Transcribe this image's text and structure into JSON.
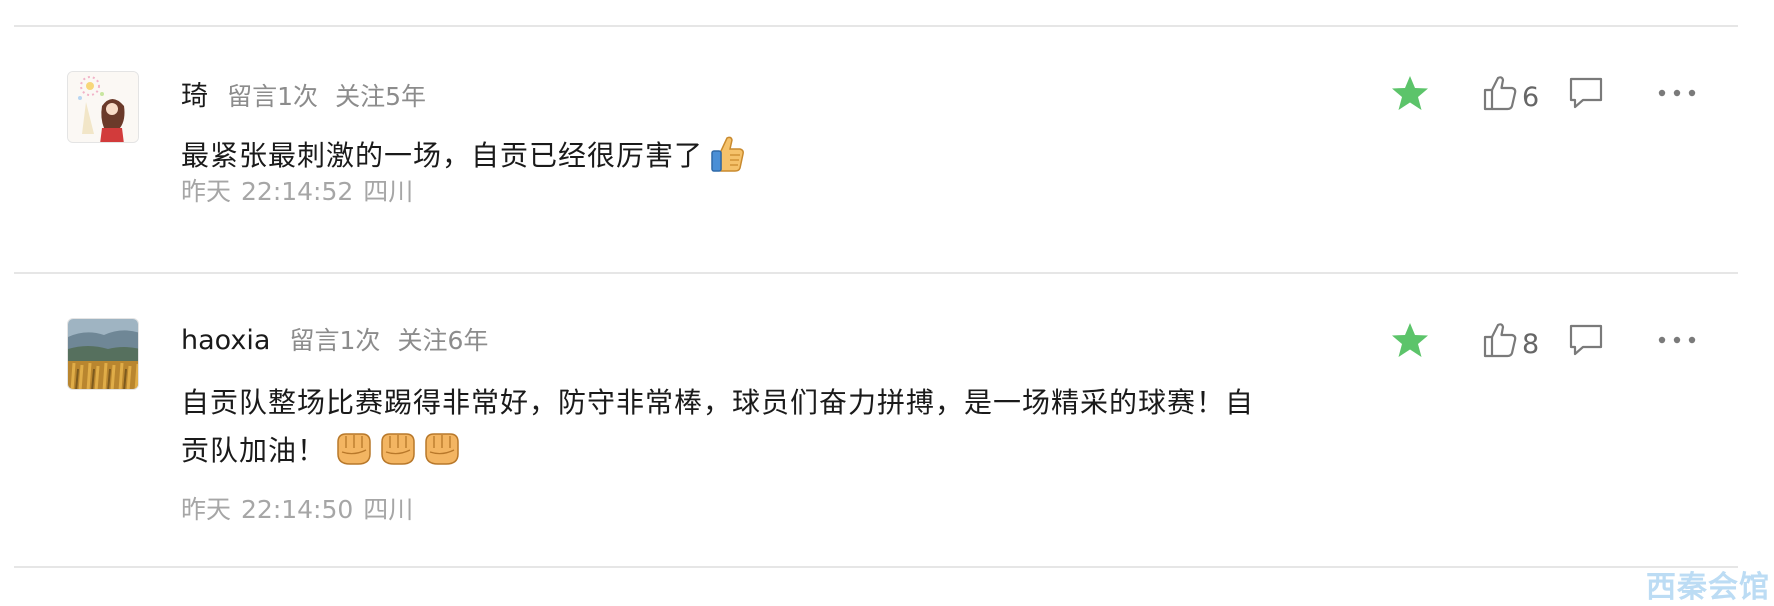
{
  "comments": [
    {
      "name": "琦",
      "tag_messages": "留言1次",
      "tag_follow": "关注5年",
      "content": "最紧张最刺激的一场，自贡已经很厉害了",
      "content_line2": "",
      "emoji": "thumbs-up",
      "time_day": "昨天",
      "time_clock": "22:14:52",
      "location": "四川",
      "likes": "6"
    },
    {
      "name": "haoxia",
      "tag_messages": "留言1次",
      "tag_follow": "关注6年",
      "content": "自贡队整场比赛踢得非常好，防守非常棒，球员们奋力拼搏，是一场精采的球赛！自",
      "content_line2": "贡队加油！",
      "emoji": "raised-fist x3",
      "time_day": "昨天",
      "time_clock": "22:14:50",
      "location": "四川",
      "likes": "8"
    }
  ],
  "icons": {
    "star": "star-icon",
    "like": "thumbs-up-icon",
    "reply": "comment-bubble-icon",
    "more": "more-dots-icon"
  },
  "colors": {
    "star": "#5cc46a",
    "icon": "#7a7a7a",
    "meta_text": "#8c8c8c",
    "time_text": "#a6a6a6",
    "divider": "#e6e6e6"
  },
  "watermark": "西秦会馆"
}
